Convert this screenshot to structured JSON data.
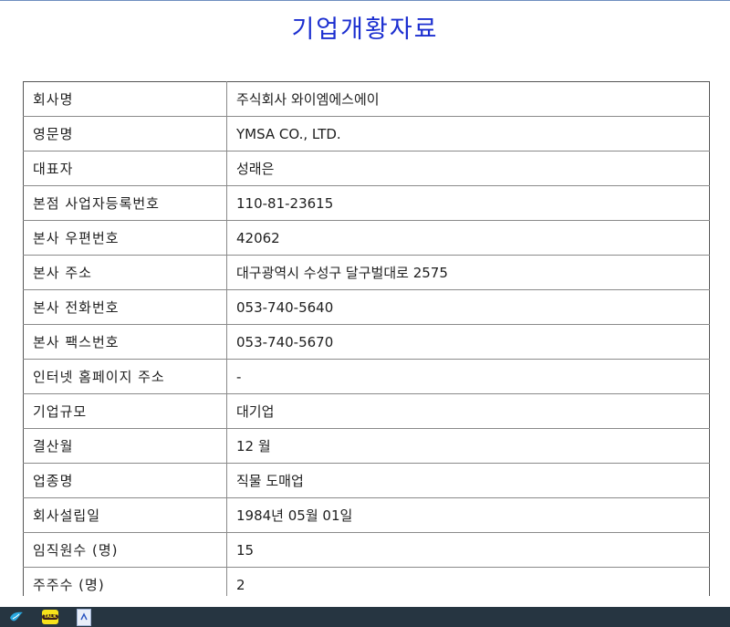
{
  "page": {
    "title": "기업개황자료"
  },
  "company_info": [
    {
      "label": "회사명",
      "value": "주식회사 와이엠에스에이"
    },
    {
      "label": "영문명",
      "value": "YMSA CO., LTD."
    },
    {
      "label": "대표자",
      "value": "성래은"
    },
    {
      "label": "본점 사업자등록번호",
      "value": "110-81-23615"
    },
    {
      "label": "본사 우편번호",
      "value": "42062"
    },
    {
      "label": "본사 주소",
      "value": "대구광역시 수성구 달구벌대로 2575"
    },
    {
      "label": "본사 전화번호",
      "value": "053-740-5640"
    },
    {
      "label": "본사 팩스번호",
      "value": "053-740-5670"
    },
    {
      "label": "인터넷 홈페이지 주소",
      "value": "-"
    },
    {
      "label": "기업규모",
      "value": "대기업"
    },
    {
      "label": "결산월",
      "value": "12 월"
    },
    {
      "label": "업종명",
      "value": "직물 도매업"
    },
    {
      "label": "회사설립일",
      "value": "1984년 05월 01일"
    },
    {
      "label": "임직원수 (명)",
      "value": "15"
    },
    {
      "label": "주주수 (명)",
      "value": "2"
    }
  ],
  "taskbar": {
    "icons": [
      "bird-app-icon",
      "kakaotalk-icon",
      "document-icon"
    ],
    "kakao_text": "TALK"
  },
  "colors": {
    "title": "#1c2fd0",
    "border": "#8a8a8a",
    "taskbar": "#263541"
  }
}
